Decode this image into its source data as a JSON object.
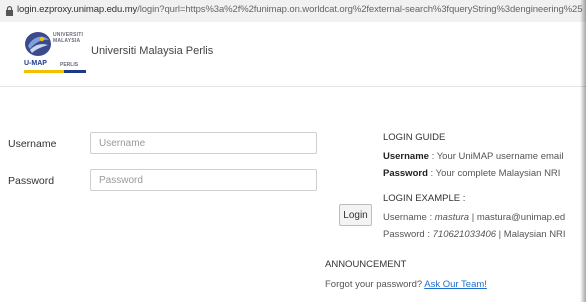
{
  "browser": {
    "url_host": "login.ezproxy.unimap.edu.my",
    "url_path": "/login?qurl=https%3a%2f%2funimap.on.worldcat.org%2fexternal-search%3fqueryString%3dengineering%25"
  },
  "header": {
    "logo_line1": "UNIVERSITI",
    "logo_line2": "MALAYSIA",
    "logo_umap": "U-MAP",
    "logo_perlis": "PERLIS",
    "site_title": "Universiti Malaysia Perlis"
  },
  "form": {
    "username_label": "Username",
    "username_placeholder": "Username",
    "password_label": "Password",
    "password_placeholder": "Password",
    "login_button": "Login"
  },
  "guide": {
    "title": "LOGIN GUIDE",
    "username_key": "Username",
    "username_text": " : Your UniMAP username email",
    "password_key": "Password",
    "password_text": "  : Your complete Malaysian NRI",
    "example_title": "LOGIN EXAMPLE :",
    "example_username_label": "Username : ",
    "example_username_value": "mastura",
    "example_username_rest": " | mastura@unimap.ed",
    "example_password_label": "Password : ",
    "example_password_value": "710621033406",
    "example_password_rest": " | Malaysian NRI"
  },
  "announcement": {
    "title": "ANNOUNCEMENT",
    "text": "Forgot your password? ",
    "link": "Ask Our Team!"
  },
  "colors": {
    "link": "#1f6fcf",
    "logo_blue": "#1c3a8a",
    "logo_yellow": "#f2c200"
  }
}
